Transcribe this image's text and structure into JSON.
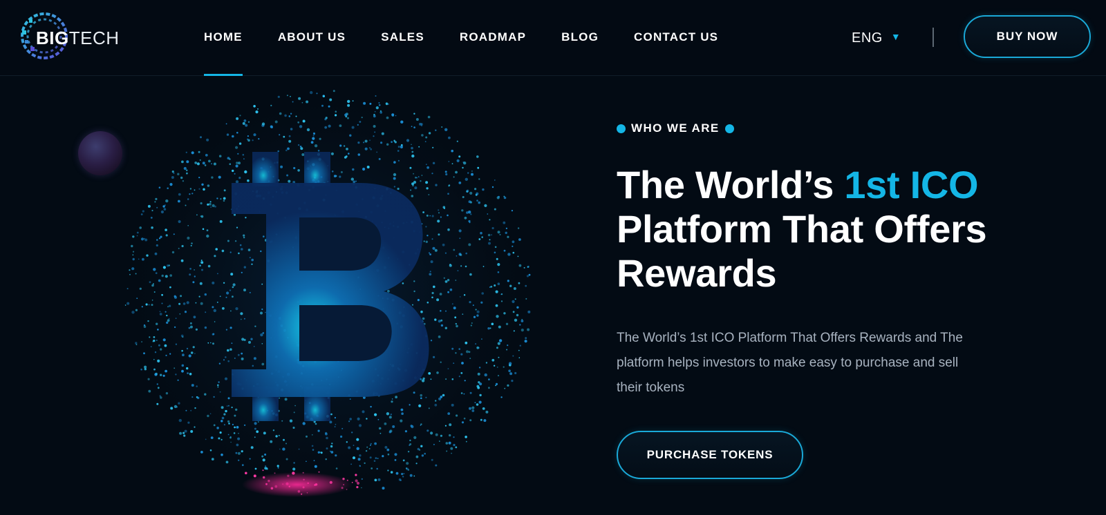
{
  "brand": {
    "logo_bold": "BIG",
    "logo_thin": "TECH",
    "accent_color": "#14b6e6",
    "background_color": "#030b14"
  },
  "nav": {
    "items": [
      {
        "label": "HOME",
        "active": true
      },
      {
        "label": "ABOUT US",
        "active": false
      },
      {
        "label": "SALES",
        "active": false
      },
      {
        "label": "ROADMAP",
        "active": false
      },
      {
        "label": "BLOG",
        "active": false
      },
      {
        "label": "CONTACT US",
        "active": false
      }
    ],
    "language": "ENG",
    "buy_label": "BUY NOW"
  },
  "hero": {
    "eyebrow": "WHO WE ARE",
    "headline_part1": "The World’s ",
    "headline_accent": "1st ICO",
    "headline_part2": "Platform That Offers Rewards",
    "description": "The World’s 1st ICO Platform That Offers Rewards and The platform helps investors to make easy to purchase and sell their tokens",
    "cta_label": "PURCHASE TOKENS",
    "illustration_icon": "bitcoin-globe-icon"
  }
}
